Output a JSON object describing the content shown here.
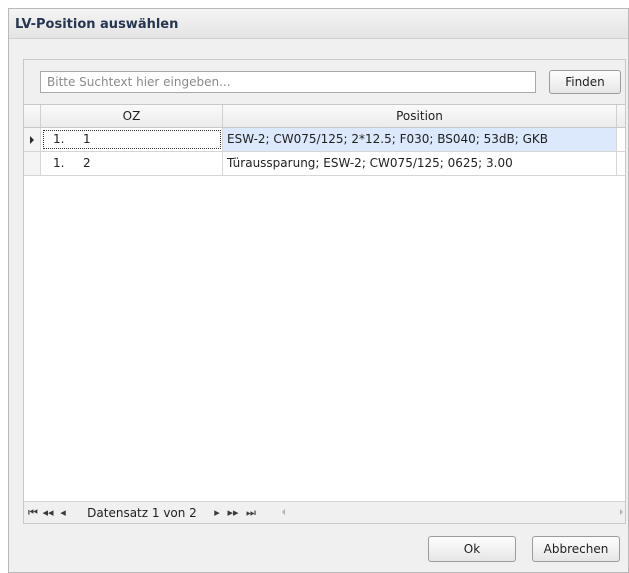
{
  "dialog": {
    "title": "LV-Position auswählen"
  },
  "search": {
    "placeholder": "Bitte Suchtext hier eingeben...",
    "value": "",
    "find_label": "Finden"
  },
  "grid": {
    "columns": [
      "OZ",
      "Position"
    ],
    "rows": [
      {
        "oz_a": "1.",
        "oz_b": "1",
        "position": "ESW-2; CW075/125; 2*12.5; F030; BS040; 53dB; GKB",
        "selected": true
      },
      {
        "oz_a": "1.",
        "oz_b": "2",
        "position": "Türaussparung; ESW-2; CW075/125; 0625; 3.00",
        "selected": false
      }
    ]
  },
  "navigator": {
    "record_text": "Datensatz 1 von 2",
    "icons": [
      "first-record-icon",
      "previous-page-icon",
      "previous-record-icon",
      "next-record-icon",
      "next-page-icon",
      "last-record-icon"
    ]
  },
  "footer": {
    "ok_label": "Ok",
    "cancel_label": "Abbrechen"
  },
  "colors": {
    "selected_row": "#dce8fb",
    "title_text": "#253650"
  }
}
